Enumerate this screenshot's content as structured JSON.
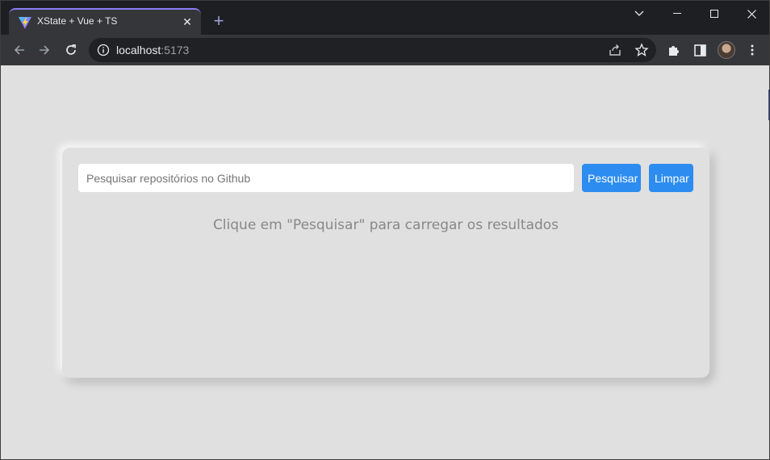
{
  "browser": {
    "tab": {
      "title": "XState + Vue + TS"
    },
    "address": {
      "host": "localhost",
      "port": ":5173"
    }
  },
  "page": {
    "search": {
      "placeholder": "Pesquisar repositórios no Github",
      "value": ""
    },
    "buttons": {
      "search_label": "Pesquisar",
      "clear_label": "Limpar"
    },
    "hint": "Clique em \"Pesquisar\" para carregar os resultados"
  },
  "colors": {
    "accent": "#2d8cf0",
    "page_bg": "#e0e0e0",
    "chrome_dark": "#1e1f23",
    "chrome_toolbar": "#35363a"
  },
  "icons": [
    "vite-favicon-icon",
    "close-icon",
    "plus-icon",
    "chevron-down-icon",
    "minimize-icon",
    "maximize-icon",
    "close-window-icon",
    "back-arrow-icon",
    "forward-arrow-icon",
    "reload-icon",
    "info-icon",
    "share-icon",
    "star-icon",
    "puzzle-icon",
    "side-panel-icon",
    "avatar",
    "kebab-menu-icon"
  ]
}
